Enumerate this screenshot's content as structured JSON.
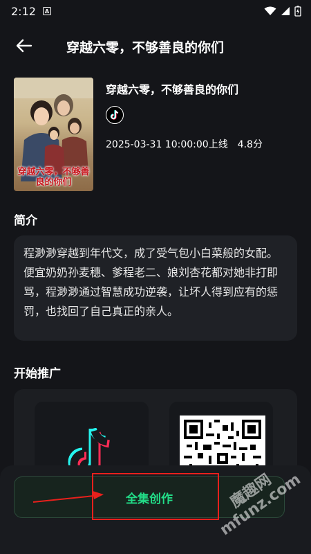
{
  "status_bar": {
    "time": "2:12",
    "notif_glyph": "A"
  },
  "header": {
    "title": "穿越六零，不够善良的你们"
  },
  "drama": {
    "poster_title": "穿越六零，不够善良的你们",
    "title": "穿越六零，不够善良的你们",
    "platform_icon": "tiktok-icon",
    "release": "2025-03-31 10:00:00上线",
    "rating": "4.8分"
  },
  "intro": {
    "heading": "简介",
    "text": "程渺渺穿越到年代文，成了受气包小白菜般的女配。便宜奶奶孙麦穗、爹程老二、娘刘杏花都对她非打即骂，程渺渺通过智慧成功逆袭，让坏人得到应有的惩罚，也找回了自己真正的亲人。"
  },
  "promo": {
    "heading": "开始推广"
  },
  "action": {
    "full_label": "全集创作"
  },
  "watermark": {
    "text": "魔趣网 mfunz.com"
  },
  "colors": {
    "background": "#141519",
    "accent_green": "#22dd88",
    "highlight_red": "#e8201c",
    "tiktok_cyan": "#25f4ee",
    "tiktok_pink": "#fe2c55"
  }
}
